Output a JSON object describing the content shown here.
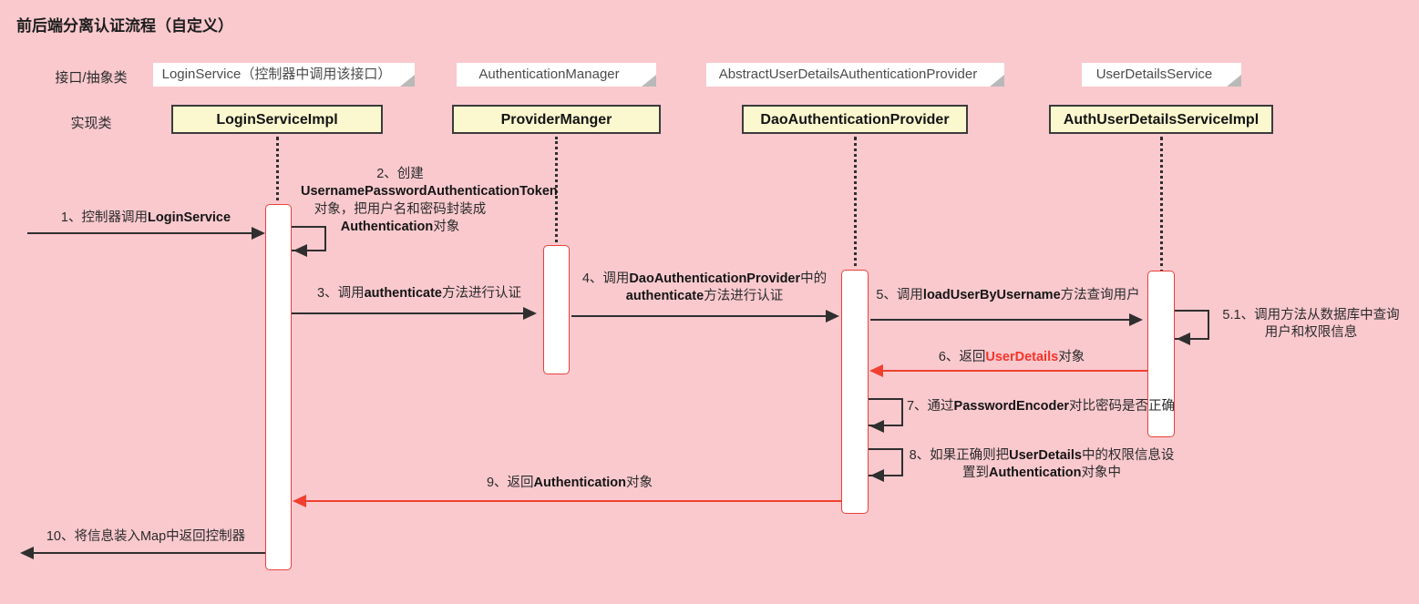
{
  "title": "前后端分离认证流程（自定义）",
  "row_labels": {
    "interface": "接口/抽象类",
    "implementation": "实现类"
  },
  "colors": {
    "background": "#f9c9ce",
    "impl_fill": "#fbf8cf",
    "impl_border": "#3b3b3b",
    "iface_fill": "#ffffff",
    "activation_border": "#e8413b",
    "arrow_dark": "#2f2f2f",
    "arrow_red": "#f0402f",
    "highlight_text": "#f5342a"
  },
  "participants": [
    {
      "interface": "LoginService（控制器中调用该接口）",
      "implementation": "LoginServiceImpl"
    },
    {
      "interface": "AuthenticationManager",
      "implementation": "ProviderManger"
    },
    {
      "interface": "AbstractUserDetailsAuthenticationProvider",
      "implementation": "DaoAuthenticationProvider"
    },
    {
      "interface": "UserDetailsService",
      "implementation": "AuthUserDetailsServiceImpl"
    }
  ],
  "messages": [
    {
      "num": "1",
      "text": "1、控制器调用LoginService"
    },
    {
      "num": "2",
      "text": "2、创建 UsernamePasswordAuthenticationToken对象，把用户名和密码封装成Authentication对象"
    },
    {
      "num": "3",
      "text": "3、调用authenticate方法进行认证"
    },
    {
      "num": "4",
      "text": "4、调用DaoAuthenticationProvider中的authenticate方法进行认证"
    },
    {
      "num": "5",
      "text": "5、调用loadUserByUsername方法查询用户"
    },
    {
      "num": "5.1",
      "text": "5.1、调用方法从数据库中查询用户和权限信息"
    },
    {
      "num": "6",
      "text": "6、返回UserDetails对象"
    },
    {
      "num": "7",
      "text": "7、通过PasswordEncoder对比密码是否正确"
    },
    {
      "num": "8",
      "text": "8、如果正确则把UserDetails中的权限信息设置到Authentication对象中"
    },
    {
      "num": "9",
      "text": "9、返回Authentication对象"
    },
    {
      "num": "10",
      "text": "10、将信息装入Map中返回控制器"
    }
  ]
}
